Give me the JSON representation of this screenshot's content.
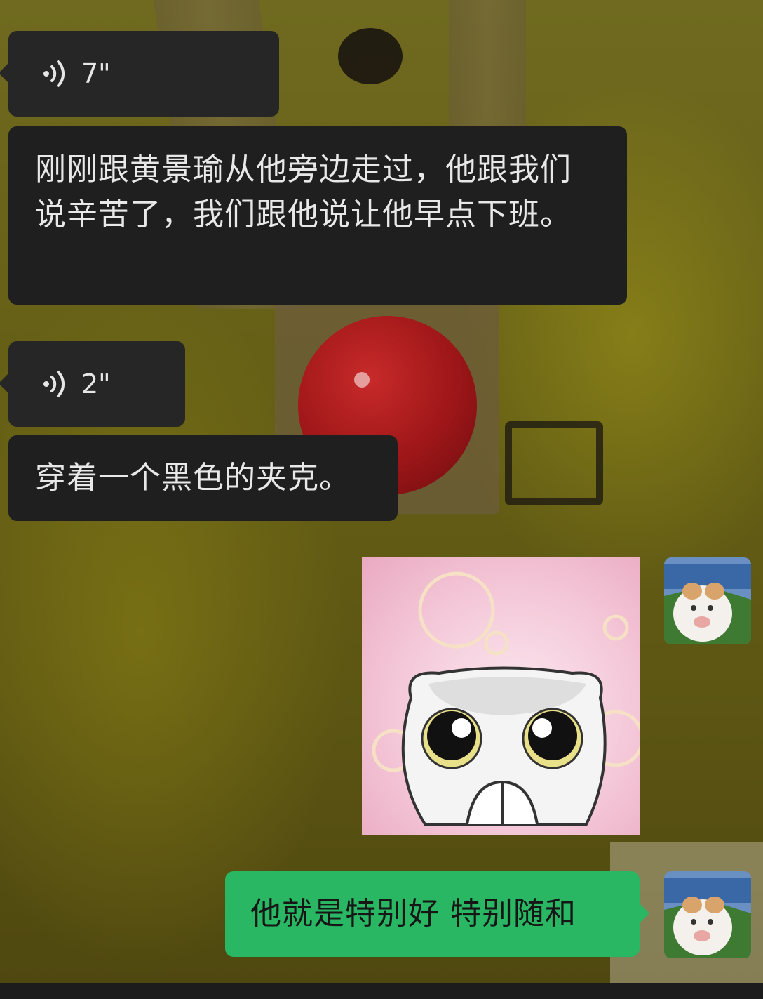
{
  "chat": {
    "messages": [
      {
        "type": "voice",
        "sender": "other",
        "duration": "7\""
      },
      {
        "type": "text",
        "sender": "other",
        "text": "刚刚跟黄景瑜从他旁边走过，他跟我们说辛苦了，我们跟他说让他早点下班。"
      },
      {
        "type": "voice",
        "sender": "other",
        "duration": "2\""
      },
      {
        "type": "text",
        "sender": "other",
        "text": "穿着一个黑色的夹克。"
      },
      {
        "type": "sticker",
        "sender": "me",
        "icon": "cute-cat-praying-sticker"
      },
      {
        "type": "text",
        "sender": "me",
        "text": "他就是特别好 特别随和"
      }
    ]
  },
  "colors": {
    "received_bubble": "#262626",
    "sent_bubble": "#29b764",
    "received_text": "#e8e8e8",
    "sent_text": "#161616"
  },
  "icons": {
    "voice": "voice-wave-icon",
    "avatar": "cat-avatar"
  }
}
